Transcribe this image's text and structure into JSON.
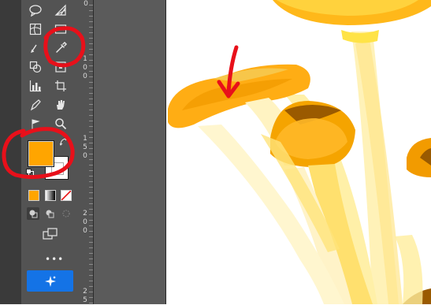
{
  "toolbar": {
    "tools": [
      {
        "name": "speech-bubble-tool-icon",
        "glyph": "💬"
      },
      {
        "name": "perspective-grid-tool-icon",
        "glyph": "▦"
      },
      {
        "name": "mesh-tool-icon",
        "glyph": "▩"
      },
      {
        "name": "gradient-tool-icon",
        "glyph": "▭"
      },
      {
        "name": "eyedropper-tool-icon",
        "glyph": ""
      },
      {
        "name": "shape-builder-tool-icon",
        "glyph": "◎"
      },
      {
        "name": "live-paint-tool-icon",
        "glyph": "⊡"
      },
      {
        "name": "graph-tool-icon",
        "glyph": "▥"
      },
      {
        "name": "artboard-tool-icon",
        "glyph": "⧉"
      },
      {
        "name": "slice-tool-icon",
        "glyph": "✎"
      },
      {
        "name": "hand-tool-icon",
        "glyph": "✋"
      },
      {
        "name": "symbol-sprayer-tool-icon",
        "glyph": "⚑"
      },
      {
        "name": "zoom-tool-icon",
        "glyph": ""
      }
    ],
    "fill_color": "#FFA500",
    "stroke_color": "#FFFFFF",
    "more_tools_label": "•••"
  },
  "ruler": {
    "labels": [
      "0",
      "1 0 0",
      "1 5 0",
      "2 0 0",
      "2 5"
    ]
  },
  "colors": {
    "annotation_red": "#E8101A",
    "toolbar_bg": "#535353",
    "accent_blue": "#1473E6"
  }
}
